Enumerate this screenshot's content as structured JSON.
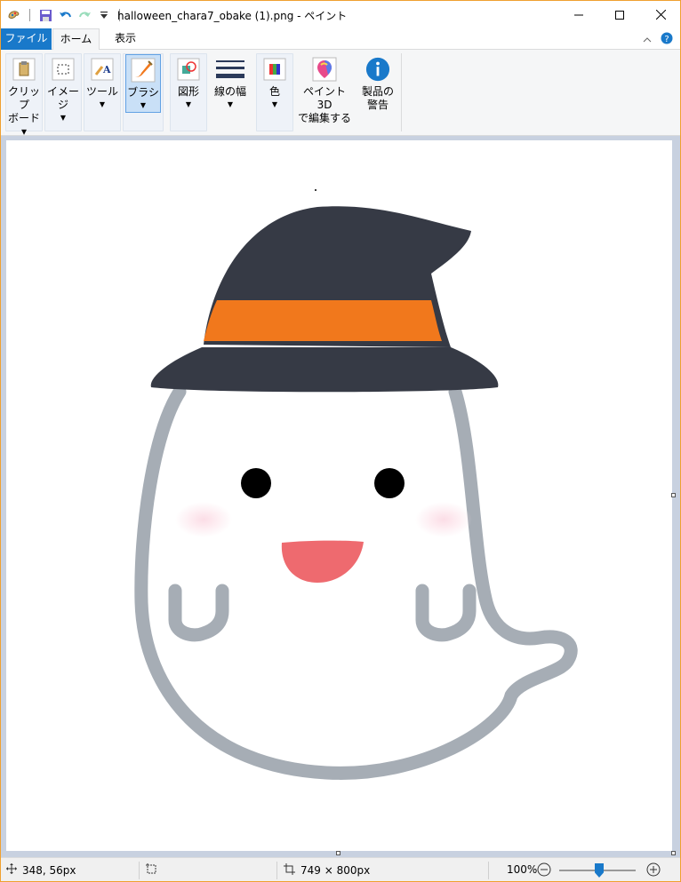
{
  "titlebar": {
    "title": "halloween_chara7_obake (1).png - ペイント",
    "qat_icons": [
      "paint-app-icon",
      "save-icon",
      "undo-icon",
      "redo-icon",
      "customize-qat-icon"
    ]
  },
  "tabs": {
    "file": "ファイル",
    "home": "ホーム",
    "view": "表示"
  },
  "ribbon": {
    "clipboard": {
      "line1": "クリップ",
      "line2": "ボード▾"
    },
    "image": {
      "line1": "イメージ"
    },
    "tools": {
      "line1": "ツール"
    },
    "brushes": {
      "line1": "ブラシ"
    },
    "shapes": {
      "line1": "図形"
    },
    "size": {
      "line1": "線の幅"
    },
    "colors": {
      "line1": "色"
    },
    "paint3d": {
      "line1": "ペイント 3D",
      "line2": "で編集する"
    },
    "warning": {
      "line1": "製品の",
      "line2": "警告"
    }
  },
  "status": {
    "cursor": "348, 56px",
    "selection": "",
    "image_size": "749 × 800px",
    "zoom": "100%",
    "zoom_level": 100
  },
  "colors": {
    "file_tab": "#1979ca",
    "hat": "#363a45",
    "hat_band": "#f1781c",
    "ghost_outline": "#a6adb5",
    "mouth": "#ee6a6f",
    "cheek": "#fcdde6"
  }
}
